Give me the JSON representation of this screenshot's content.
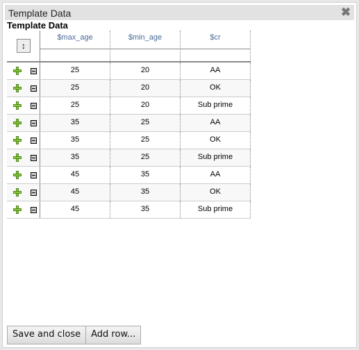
{
  "window": {
    "title": "Template Data"
  },
  "section_title": "Template Data",
  "grid": {
    "columns": [
      "$max_age",
      "$min_age",
      "$cr"
    ],
    "rows": [
      [
        "25",
        "20",
        "AA"
      ],
      [
        "25",
        "20",
        "OK"
      ],
      [
        "25",
        "20",
        "Sub prime"
      ],
      [
        "35",
        "25",
        "AA"
      ],
      [
        "35",
        "25",
        "OK"
      ],
      [
        "35",
        "25",
        "Sub prime"
      ],
      [
        "45",
        "35",
        "AA"
      ],
      [
        "45",
        "35",
        "OK"
      ],
      [
        "45",
        "35",
        "Sub prime"
      ]
    ]
  },
  "buttons": {
    "save_close": "Save and close",
    "add_row": "Add row..."
  },
  "icons": {
    "close": "✖",
    "columns": "↕"
  }
}
